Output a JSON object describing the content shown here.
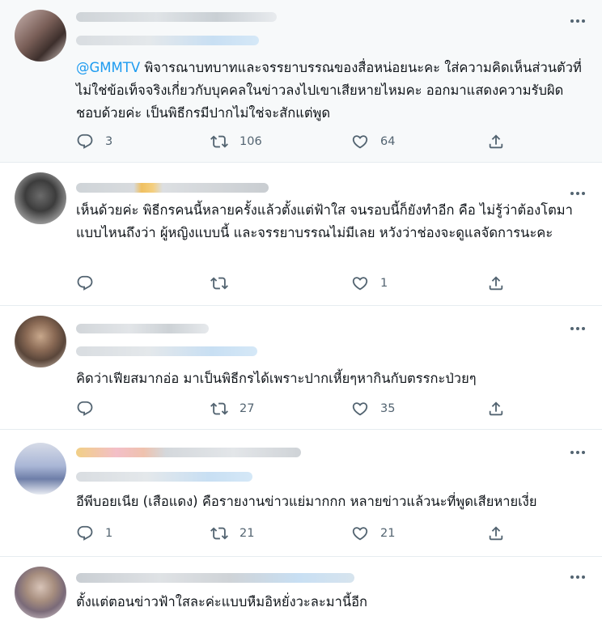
{
  "tweets": [
    {
      "mention": "@GMMTV",
      "text": " พิจารณาบทบาทและจรรยาบรรณของสื่อหน่อยนะคะ ใส่ความคิดเห็นส่วนตัวที่ไม่ใช่ข้อเท็จจริงเกี่ยวกับบุคคลในข่าวลงไปเขาเสียหายไหมคะ ออกมาแสดงความรับผิดชอบด้วยค่ะ เป็นพิธีกรมีปากไม่ใช่จะสักแต่พูด",
      "reply_count": "3",
      "retweet_count": "106",
      "like_count": "64"
    },
    {
      "mention": "",
      "text": "เห็นด้วยค่ะ พิธีกรคนนี้หลายครั้งแล้วตั้งแต่ฟ้าใส จนรอบนี้ก็ยังทำอีก คือ ไม่รู้ว่าต้องโตมาแบบไหนถึงว่า ผู้หญิงแบบนี้ และจรรยาบรรณไม่มีเลย หวังว่าช่องจะดูแลจัดการนะคะ",
      "reply_count": "",
      "retweet_count": "",
      "like_count": "1"
    },
    {
      "mention": "",
      "text": "คิดว่าเฟียสมากอ่อ มาเป็นพิธีกรได้เพราะปากเหี้ยๆหากินกับตรรกะป่วยๆ",
      "reply_count": "",
      "retweet_count": "27",
      "like_count": "35"
    },
    {
      "mention": "",
      "text": "อีพีบอยเนีย (เสือแดง) คือรายงานข่าวแย่มากกก หลายข่าวแล้วนะที่พูดเสียหายเงี่ย",
      "reply_count": "1",
      "retweet_count": "21",
      "like_count": "21"
    },
    {
      "mention": "",
      "text": "ตั้งแต่ตอนข่าวฟ้าใสละค่ะแบบหืมอิหยั่งวะละมานี้อีก",
      "reply_count": "",
      "retweet_count": "",
      "like_count": ""
    }
  ],
  "icons": {
    "reply": "reply-icon",
    "retweet": "retweet-icon",
    "like": "like-icon",
    "share": "share-icon",
    "more": "more-icon"
  },
  "colors": {
    "text": "#0f1419",
    "muted": "#536471",
    "accent": "#1d9bf0",
    "highlight_bg": "#f7f9fa",
    "divider": "#e6ecf0"
  }
}
